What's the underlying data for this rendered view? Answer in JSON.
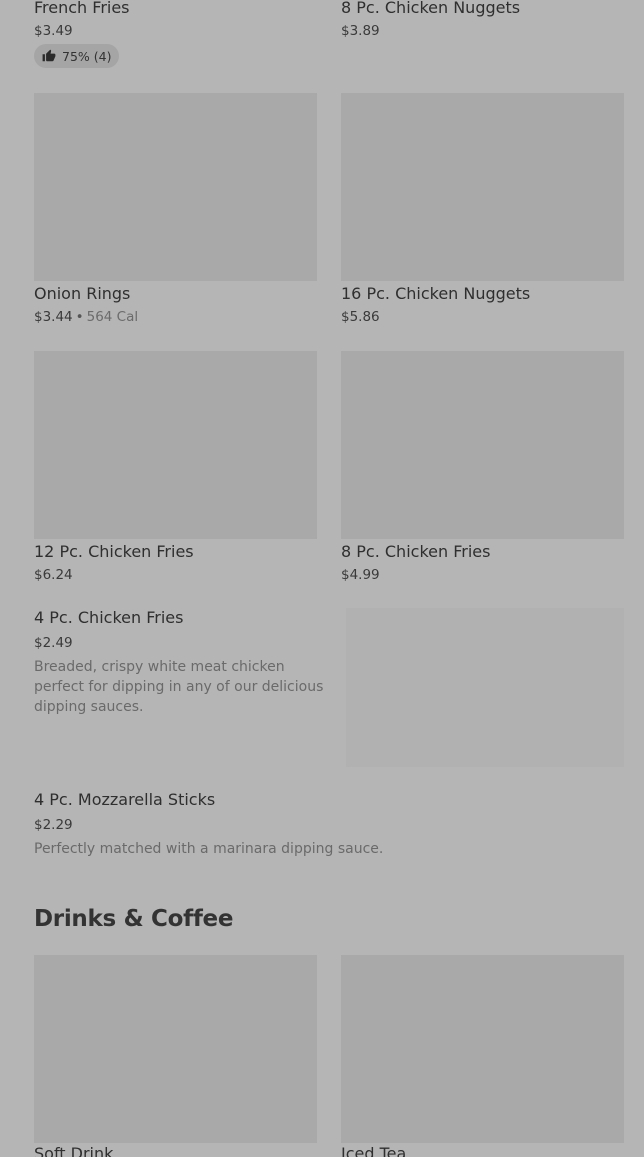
{
  "items": [
    {
      "name": "French Fries",
      "price": "$3.49",
      "rating": "75% (4)"
    },
    {
      "name": "8 Pc. Chicken Nuggets",
      "price": "$3.89"
    },
    {
      "name": "Onion Rings",
      "price": "$3.44",
      "separator": "•",
      "calories": "564 Cal"
    },
    {
      "name": "16 Pc. Chicken Nuggets",
      "price": "$5.86"
    },
    {
      "name": "12 Pc. Chicken Fries",
      "price": "$6.24"
    },
    {
      "name": "8 Pc. Chicken Fries",
      "price": "$4.99"
    },
    {
      "name": "4 Pc. Chicken Fries",
      "price": "$2.49",
      "description": "Breaded, crispy white meat chicken perfect for dipping in any of our delicious dipping sauces."
    },
    {
      "name": "4 Pc. Mozzarella Sticks",
      "price": "$2.29",
      "description": "Perfectly matched with a marinara dipping sauce."
    }
  ],
  "sections": {
    "drinks_title": "Drinks & Coffee"
  },
  "drinks": [
    {
      "name": "Soft Drink"
    },
    {
      "name": "Iced Tea"
    }
  ],
  "icons": {
    "rating": "thumbs-up-icon"
  }
}
